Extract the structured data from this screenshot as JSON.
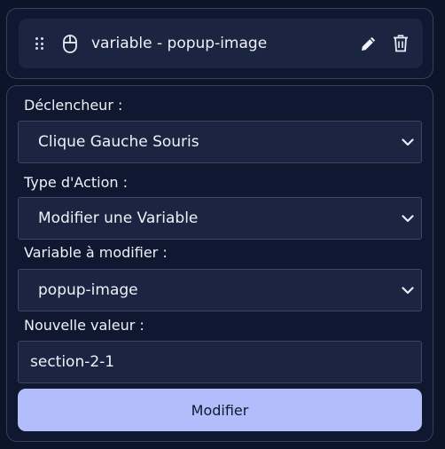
{
  "header": {
    "title": "variable - popup-image",
    "icons": {
      "drag": "drag-handle-icon",
      "trigger": "mouse-icon",
      "edit": "pencil-icon",
      "delete": "trash-icon"
    }
  },
  "form": {
    "trigger": {
      "label": "Déclencheur :",
      "selected": "Clique Gauche Souris"
    },
    "action_type": {
      "label": "Type d'Action :",
      "selected": "Modifier une Variable"
    },
    "variable": {
      "label": "Variable à modifier :",
      "selected": "popup-image"
    },
    "new_value": {
      "label": "Nouvelle valeur :",
      "value": "section-2-1"
    },
    "submit_label": "Modifier"
  },
  "colors": {
    "background": "#0c1429",
    "card": "#0f1830",
    "field": "#1b2440",
    "border": "#34415e",
    "button": "#b4bdfc",
    "text": "#eef1f8"
  }
}
